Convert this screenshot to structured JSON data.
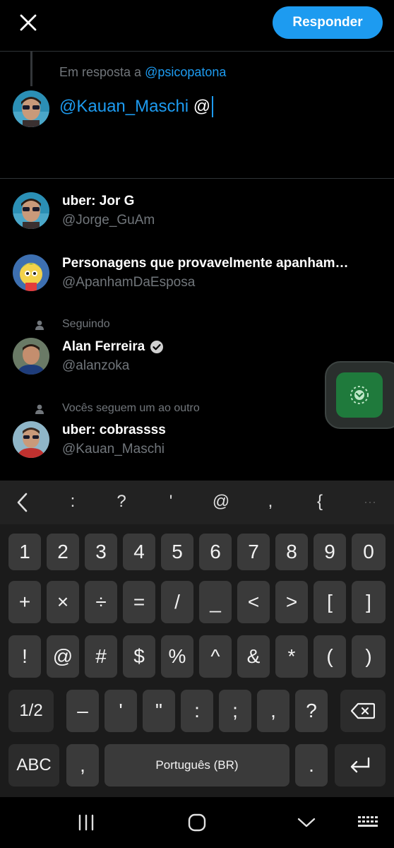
{
  "header": {
    "close_icon": "close-icon",
    "reply_label": "Responder"
  },
  "compose": {
    "reply_prefix": "Em resposta a",
    "reply_handle": "@psicopatona",
    "mention": "@Kauan_Maschi",
    "typed": " @"
  },
  "suggestions": [
    {
      "name": "uber: Jor G",
      "username": "@Jorge_GuAm",
      "context": "",
      "verified": false
    },
    {
      "name": "Personagens que provavelmente apanham…",
      "username": "@ApanhamDaEsposa",
      "context": "",
      "verified": false
    },
    {
      "name": "Alan Ferreira",
      "username": "@alanzoka",
      "context": "Seguindo",
      "verified": true
    },
    {
      "name": "uber: cobrassss",
      "username": "@Kauan_Maschi",
      "context": "Vocês seguem um ao outro",
      "verified": false
    }
  ],
  "keyboard": {
    "toolbar": [
      "<",
      ":",
      "?",
      "'",
      "@",
      ",",
      "{",
      "···"
    ],
    "row1": [
      "1",
      "2",
      "3",
      "4",
      "5",
      "6",
      "7",
      "8",
      "9",
      "0"
    ],
    "row2": [
      "+",
      "×",
      "÷",
      "=",
      "/",
      "_",
      "<",
      ">",
      "[",
      "]"
    ],
    "row3": [
      "!",
      "@",
      "#",
      "$",
      "%",
      "^",
      "&",
      "*",
      "(",
      ")"
    ],
    "row4": [
      "1/2",
      "–",
      "'",
      "\"",
      ":",
      ";",
      ",",
      "?"
    ],
    "row5": {
      "abc": "ABC",
      "comma": ",",
      "space": "Português (BR)",
      "period": ".",
      "enter_icon": "enter-icon"
    },
    "backspace_icon": "backspace-icon"
  },
  "colors": {
    "accent": "#1d9bf0",
    "widget": "#1f7a3c"
  }
}
